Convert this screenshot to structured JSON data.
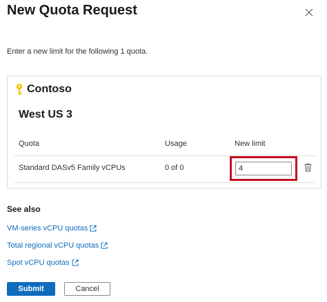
{
  "panel": {
    "title": "New Quota Request",
    "intro": "Enter a new limit for the following 1 quota."
  },
  "card": {
    "account": "Contoso",
    "region": "West US 3",
    "columns": {
      "quota": "Quota",
      "usage": "Usage",
      "new_limit": "New limit"
    },
    "row": {
      "quota": "Standard DASv5 Family vCPUs",
      "usage": "0 of 0",
      "new_limit": "4"
    }
  },
  "see_also": {
    "heading": "See also",
    "links": [
      "VM-series vCPU quotas",
      "Total regional vCPU quotas",
      "Spot vCPU quotas"
    ]
  },
  "actions": {
    "submit": "Submit",
    "cancel": "Cancel"
  },
  "colors": {
    "accent": "#0f6cbd",
    "highlight": "#c50f1f",
    "key_icon": "#f2c811"
  },
  "icons": {
    "close": "close-icon",
    "account": "key-icon",
    "delete": "trash-icon",
    "external": "external-link-icon"
  }
}
